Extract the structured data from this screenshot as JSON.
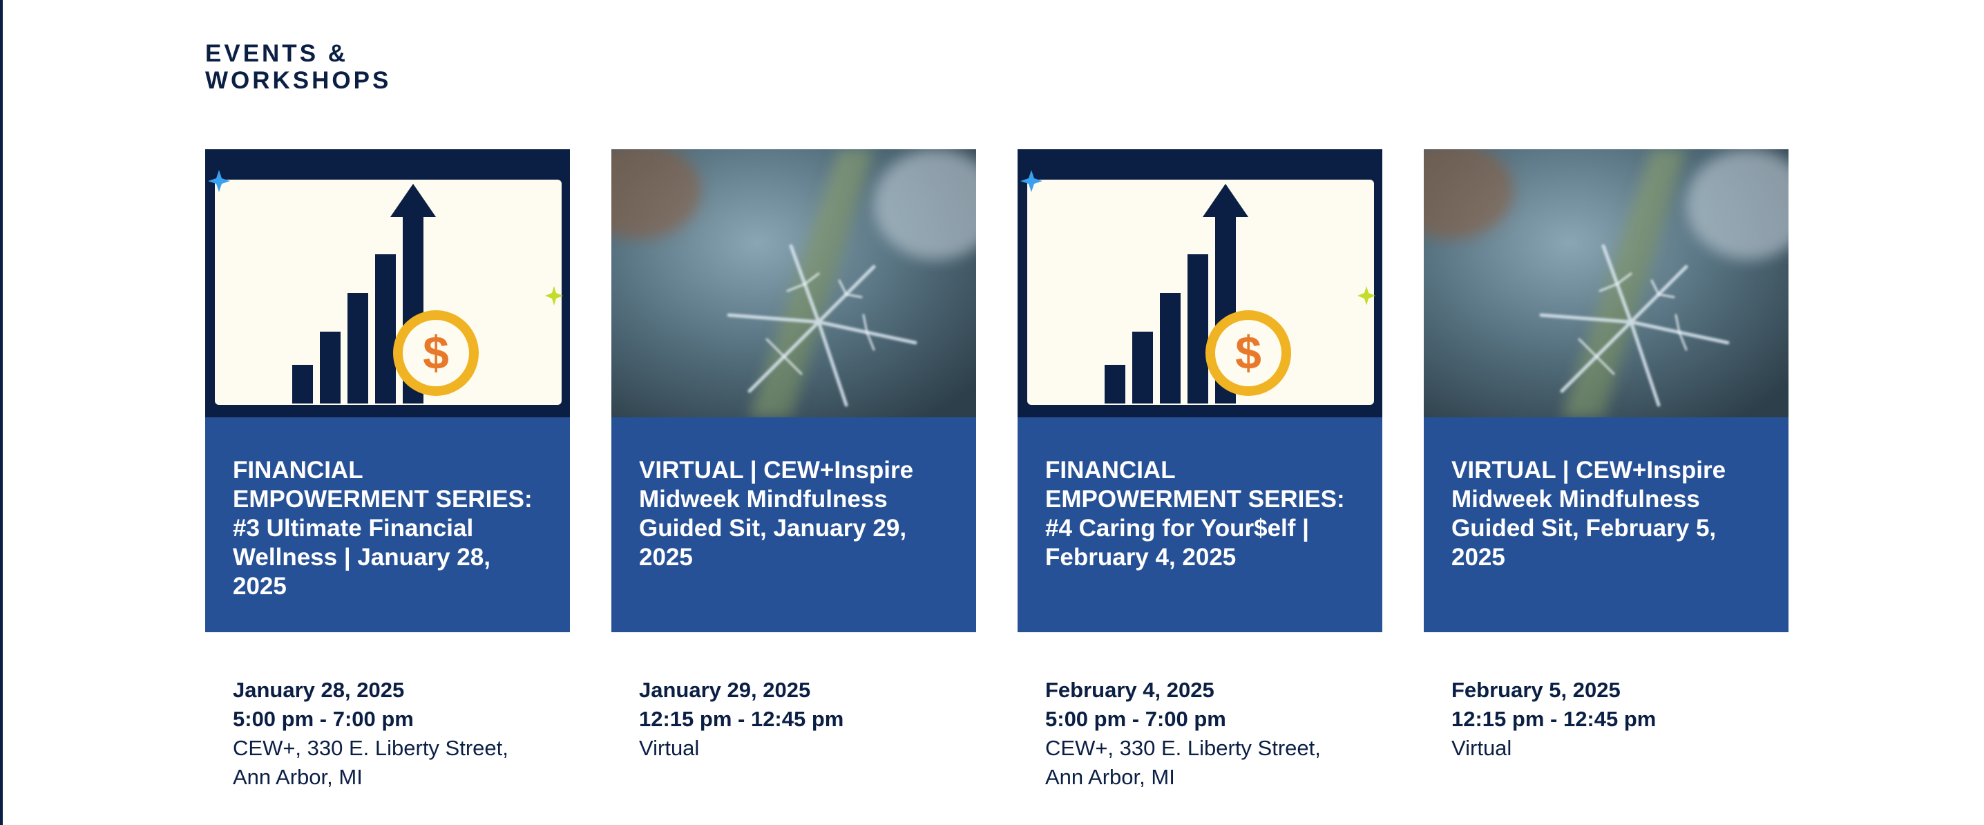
{
  "section": {
    "heading_line1": "EVENTS &",
    "heading_line2": "WORKSHOPS"
  },
  "colors": {
    "navy": "#0b1f44",
    "title_box_blue": "#275196",
    "coin_gold": "#f0b323",
    "coin_dollar_orange": "#e8782a",
    "sparkle_blue": "#3aa0f0",
    "sparkle_green": "#c4dc2a"
  },
  "events": [
    {
      "image": "financial-growth-chart-coin-icon",
      "title": "FINANCIAL EMPOWERMENT SERIES: #3 Ultimate Financial Wellness | January 28, 2025",
      "date": "January 28, 2025",
      "time": "5:00 pm - 7:00 pm",
      "location_line1": "CEW+, 330 E. Liberty Street,",
      "location_line2": "Ann Arbor, MI"
    },
    {
      "image": "snowflake-photo",
      "title": "VIRTUAL | CEW+Inspire Midweek Mindfulness Guided Sit, January 29, 2025",
      "date": "January 29, 2025",
      "time": "12:15 pm - 12:45 pm",
      "location_line1": "Virtual",
      "location_line2": ""
    },
    {
      "image": "financial-growth-chart-coin-icon",
      "title": "FINANCIAL EMPOWERMENT SERIES: #4 Caring for Your$elf | February 4, 2025",
      "date": "February 4, 2025",
      "time": "5:00 pm - 7:00 pm",
      "location_line1": "CEW+, 330 E. Liberty Street,",
      "location_line2": "Ann Arbor, MI"
    },
    {
      "image": "snowflake-photo",
      "title": "VIRTUAL | CEW+Inspire Midweek Mindfulness Guided Sit, February 5, 2025",
      "date": "February 5, 2025",
      "time": "12:15 pm - 12:45 pm",
      "location_line1": "Virtual",
      "location_line2": ""
    }
  ]
}
